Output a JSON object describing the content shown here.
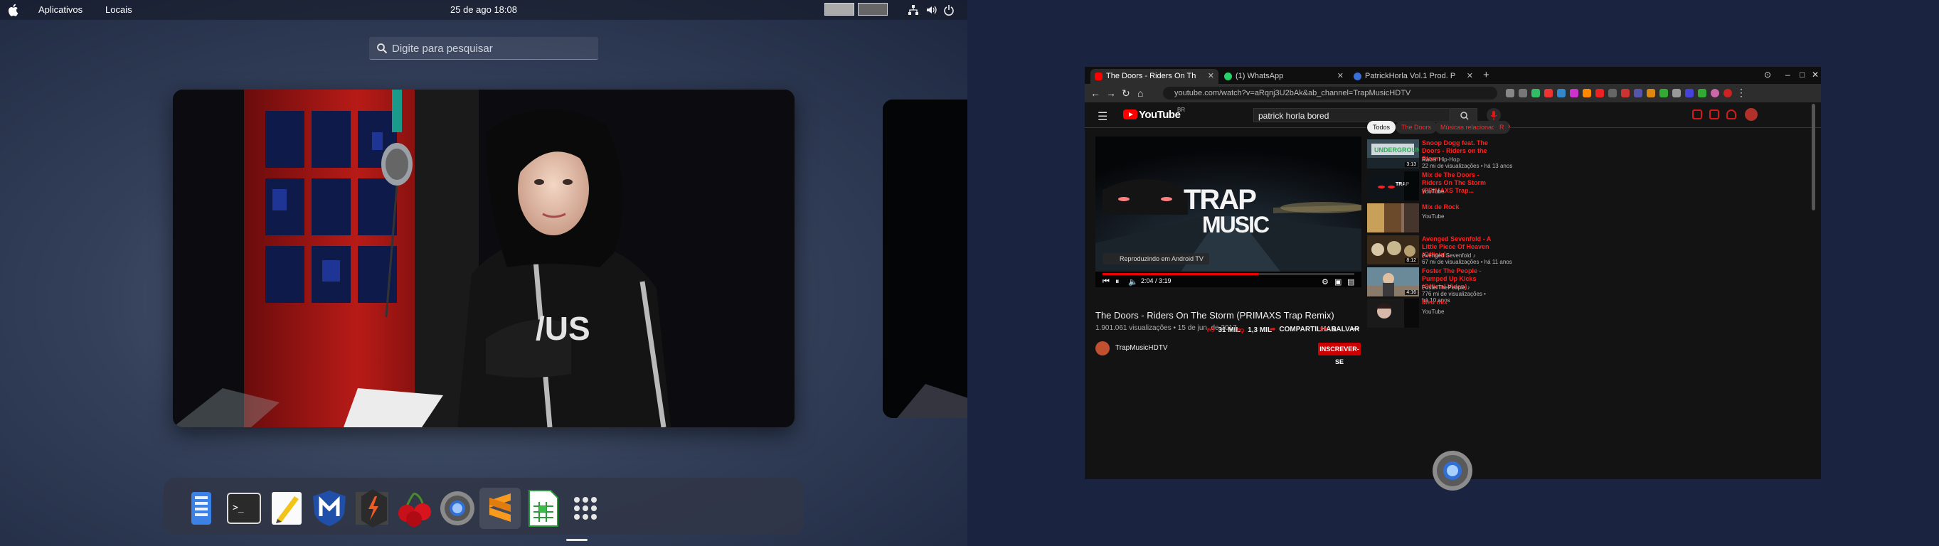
{
  "topbar": {
    "apps_menu": "Aplicativos",
    "places_menu": "Locais",
    "clock": "25 de ago  18:08"
  },
  "search": {
    "placeholder": "Digite para pesquisar"
  },
  "dock": {
    "apps": [
      "files-icon",
      "terminal-icon",
      "text-editor-icon",
      "metasploit-icon",
      "burp-suite-icon",
      "cherrytree-icon",
      "chrome-icon",
      "sublime-text-icon",
      "calc-icon",
      "show-apps-icon"
    ]
  },
  "browser": {
    "tabs": [
      {
        "label": "The Doors - Riders On Th",
        "color": "#ff0000"
      },
      {
        "label": "(1) WhatsApp",
        "color": "#25d366"
      },
      {
        "label": "PatrickHorla Vol.1 Prod. P",
        "color": "#3a6fd8"
      }
    ],
    "url": "youtube.com/watch?v=aRqnj3U2bAk&ab_channel=TrapMusicHDTV"
  },
  "youtube": {
    "logo": "YouTube",
    "country": "BR",
    "search_query": "patrick horla  bored",
    "player": {
      "cast_label": "Reproduzindo em Android TV",
      "time": "2:04 / 3:19",
      "progress": 0.62
    },
    "video_title": "The Doors - Riders On The Storm (PRIMAXS Trap Remix)",
    "video_meta": "1.901.061 visualizações • 15 de jun. de 2017",
    "likes": "31 MIL",
    "dislikes": "1,3 MIL",
    "share": "COMPARTILHAR",
    "save": "SALVAR",
    "more": "•••",
    "channel": "TrapMusicHDTV",
    "subscribe": "INSCREVER-SE",
    "chips": [
      "Todos",
      "The Doors",
      "Músicas relacionadas",
      "R"
    ],
    "recommendations": [
      {
        "title": "Snoop Dogg feat. The Doors - Riders on the Storm",
        "channel": "Racer Hip-Hop",
        "stats": "22 mi de visualizações • há 13 anos",
        "duration": "3:13"
      },
      {
        "title": "Mix de The Doors - Riders On The Storm (PRIMAXS Trap...",
        "channel": "YouTube",
        "stats": "",
        "duration": ""
      },
      {
        "title": "Mix de Rock",
        "channel": "YouTube",
        "stats": "",
        "duration": ""
      },
      {
        "title": "Avenged Sevenfold - A Little Piece Of Heaven (Official...",
        "channel": "Avenged Sevenfold ♪",
        "stats": "67 mi de visualizações • há 11 anos",
        "duration": "8:12"
      },
      {
        "title": "Foster The People - Pumped Up Kicks (Official Video)",
        "channel": "FosterThePeople ♪",
        "stats": "776 mi de visualizações •",
        "stats2": "há 10 anos",
        "duration": "4:16"
      },
      {
        "title": "Meu mix",
        "channel": "YouTube",
        "stats": "",
        "duration": ""
      }
    ]
  },
  "colors": {
    "accent_red": "#e01818",
    "desktop_dark": "#1a2440"
  }
}
